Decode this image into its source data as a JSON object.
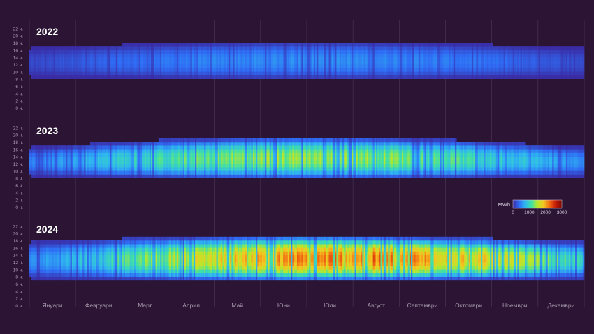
{
  "chart_data": {
    "type": "heatmap",
    "description_x": "month",
    "description_y": "hour of day",
    "months": [
      "Януари",
      "Февруари",
      "Март",
      "Април",
      "Май",
      "Юни",
      "Юли",
      "Август",
      "Септември",
      "Октомври",
      "Ноември",
      "Декември"
    ],
    "hour_ticks": [
      "22 ч.",
      "20 ч.",
      "18 ч.",
      "16 ч.",
      "14 ч.",
      "12 ч.",
      "10 ч.",
      "8 ч.",
      "6 ч.",
      "4 ч.",
      "2 ч.",
      "0 ч."
    ],
    "panels": [
      {
        "year": "2022",
        "peak_mwh": 650,
        "day_start_winter": 9,
        "day_end_winter": 16,
        "day_start_summer": 8,
        "day_end_summer": 18
      },
      {
        "year": "2023",
        "peak_mwh": 1700,
        "day_start_winter": 9,
        "day_end_winter": 16,
        "day_start_summer": 8,
        "day_end_summer": 19
      },
      {
        "year": "2024",
        "peak_mwh": 3100,
        "day_start_winter": 8,
        "day_end_winter": 17,
        "day_start_summer": 7,
        "day_end_summer": 19
      }
    ],
    "legend": {
      "unit": "MWh",
      "range": [
        0,
        3000
      ],
      "ticks": [
        "0",
        "1000",
        "2000",
        "3000"
      ],
      "colormap": [
        "#3b28a0",
        "#2f6cf5",
        "#2fb7f0",
        "#3fe0a8",
        "#b8e82a",
        "#f5c722",
        "#f26a12",
        "#c31a08",
        "#7a0b04"
      ]
    }
  }
}
